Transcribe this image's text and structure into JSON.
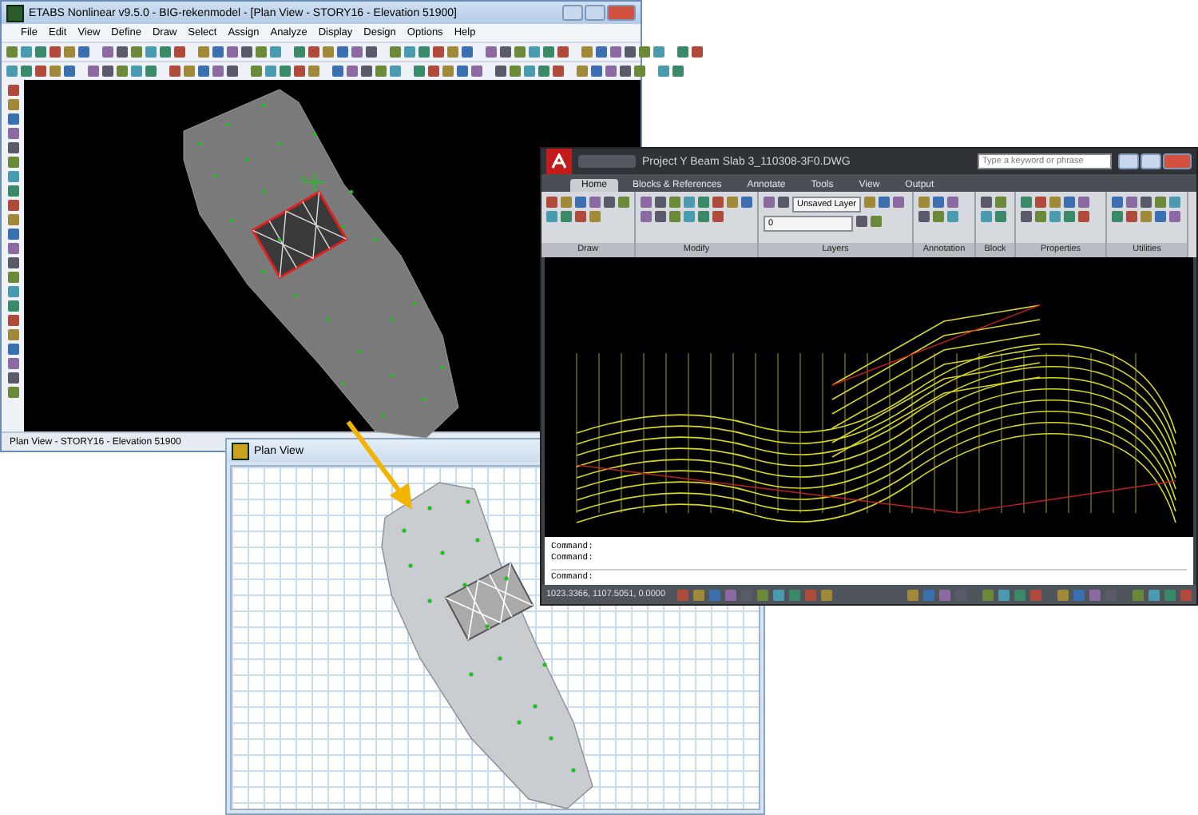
{
  "etabs_window": {
    "title": "ETABS Nonlinear v9.5.0 - BIG-rekenmodel - [Plan View - STORY16 - Elevation 51900]",
    "menu": [
      "File",
      "Edit",
      "View",
      "Define",
      "Draw",
      "Select",
      "Assign",
      "Analyze",
      "Display",
      "Design",
      "Options",
      "Help"
    ],
    "status_bar": "Plan View - STORY16 - Elevation 51900"
  },
  "plan_view_window": {
    "title": "Plan View"
  },
  "autocad_window": {
    "title": "Project Y Beam Slab 3_110308-3F0.DWG",
    "search": {
      "placeholder": "Type a keyword or phrase"
    },
    "tabs": [
      {
        "label": "Home",
        "selected": true
      },
      {
        "label": "Blocks & References",
        "selected": false
      },
      {
        "label": "Annotate",
        "selected": false
      },
      {
        "label": "Tools",
        "selected": false
      },
      {
        "label": "View",
        "selected": false
      },
      {
        "label": "Output",
        "selected": false
      }
    ],
    "layer_dropdown": "Unsaved Layer",
    "layer_state_dropdown": "0",
    "panels": [
      "Draw",
      "Modify",
      "Layers",
      "Annotation",
      "Block",
      "Properties",
      "Utilities"
    ],
    "command_history": [
      "Command:",
      "Command:"
    ],
    "command_prompt": "Command:",
    "coordinates": "1023.3366, 1107.5051, 0.0000"
  }
}
